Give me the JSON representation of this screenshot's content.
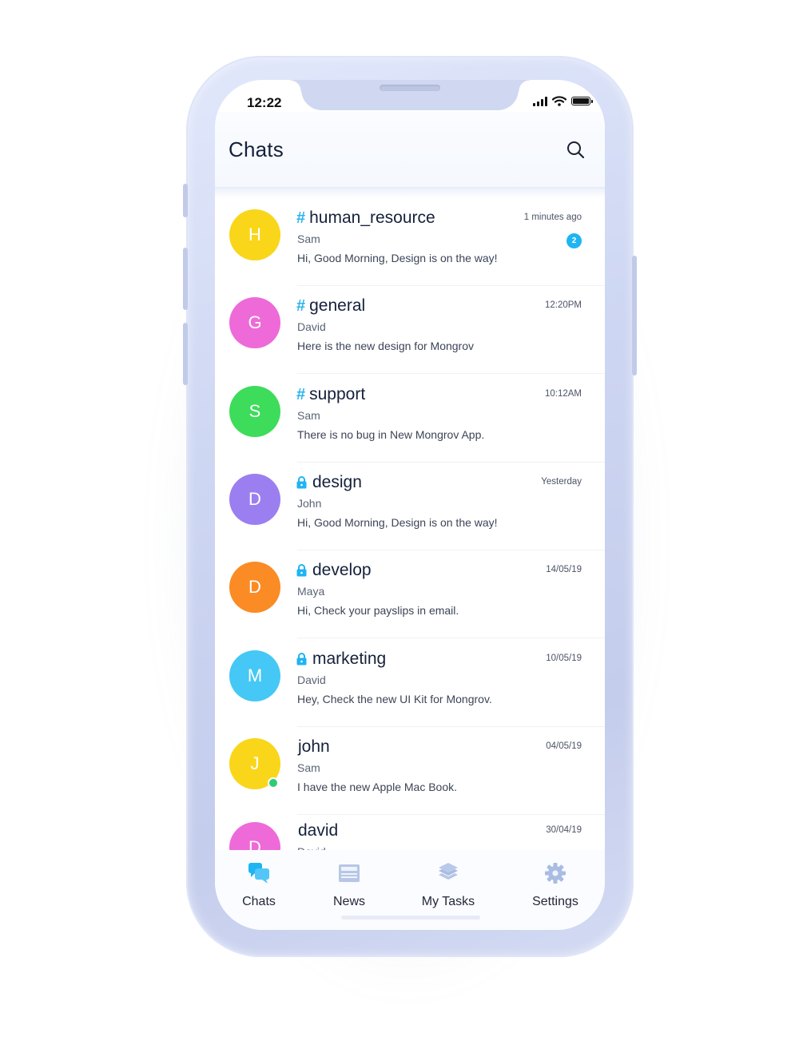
{
  "status_bar": {
    "time": "12:22"
  },
  "header": {
    "title": "Chats",
    "search_icon": "search-icon"
  },
  "chats": [
    {
      "initial": "H",
      "color": "#f9d61a",
      "type": "public",
      "name": "human_resource",
      "sender": "Sam",
      "preview": "Hi, Good Morning, Design is on the way!",
      "time": "1 minutes ago",
      "unread": "2",
      "online": false
    },
    {
      "initial": "G",
      "color": "#ee6ad8",
      "type": "public",
      "name": "general",
      "sender": "David",
      "preview": "Here is the new design for Mongrov",
      "time": "12:20PM",
      "unread": null,
      "online": false
    },
    {
      "initial": "S",
      "color": "#3ddc5a",
      "type": "public",
      "name": "support",
      "sender": "Sam",
      "preview": "There is no bug in New Mongrov App.",
      "time": "10:12AM",
      "unread": null,
      "online": false
    },
    {
      "initial": "D",
      "color": "#9b7ff0",
      "type": "private",
      "name": "design",
      "sender": "John",
      "preview": "Hi, Good Morning, Design is on the way!",
      "time": "Yesterday",
      "unread": null,
      "online": false
    },
    {
      "initial": "D",
      "color": "#fb8b24",
      "type": "private",
      "name": "develop",
      "sender": "Maya",
      "preview": "Hi, Check your payslips in email.",
      "time": "14/05/19",
      "unread": null,
      "online": false
    },
    {
      "initial": "M",
      "color": "#45c8f5",
      "type": "private",
      "name": "marketing",
      "sender": "David",
      "preview": "Hey, Check the new UI Kit for Mongrov.",
      "time": "10/05/19",
      "unread": null,
      "online": false
    },
    {
      "initial": "J",
      "color": "#f9d61a",
      "type": "direct",
      "name": "john",
      "sender": "Sam",
      "preview": "I have the new Apple Mac Book.",
      "time": "04/05/19",
      "unread": null,
      "online": true
    },
    {
      "initial": "D",
      "color": "#ee6ad8",
      "type": "direct",
      "name": "david",
      "sender": "David",
      "preview": "",
      "time": "30/04/19",
      "unread": null,
      "online": false
    }
  ],
  "tabs": [
    {
      "label": "Chats",
      "icon": "chat-bubbles-icon",
      "active": true
    },
    {
      "label": "News",
      "icon": "newspaper-icon",
      "active": false
    },
    {
      "label": "My Tasks",
      "icon": "layers-icon",
      "active": false
    },
    {
      "label": "Settings",
      "icon": "gear-icon",
      "active": false
    }
  ],
  "colors": {
    "accent": "#1fb4f2",
    "inactive_icon": "#9fb3d8",
    "title": "#15213b"
  }
}
